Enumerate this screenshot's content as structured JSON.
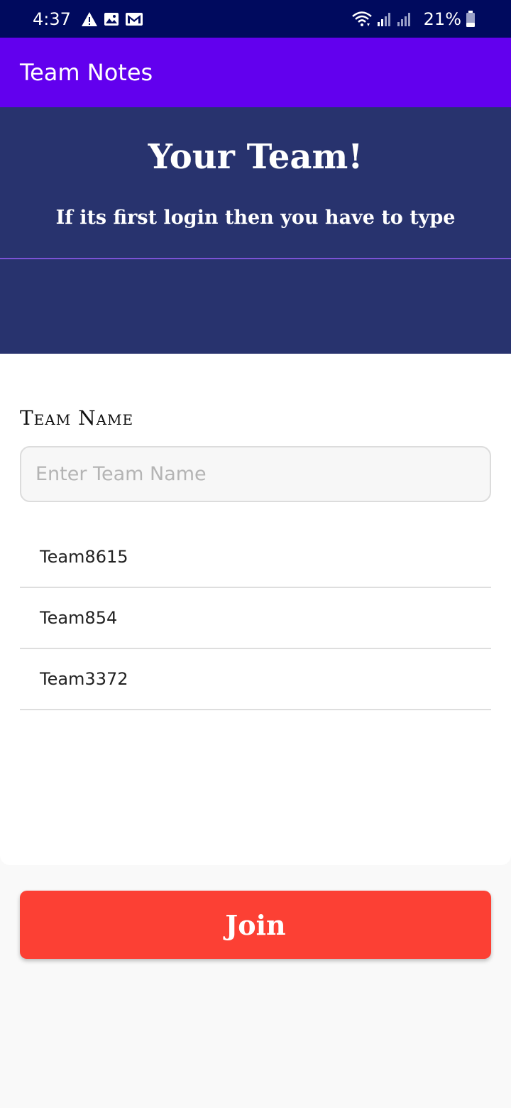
{
  "status_bar": {
    "time": "4:37",
    "battery": "21%",
    "icons": [
      "warning-icon",
      "image-icon",
      "gmail-icon",
      "wifi-icon",
      "signal-icon",
      "signal-icon",
      "battery-icon"
    ]
  },
  "app_bar": {
    "title": "Team Notes"
  },
  "hero": {
    "title": "Your Team!",
    "subtitle": "If its first login then you have to type"
  },
  "form": {
    "label": "Team Name",
    "input_placeholder": "Enter Team Name",
    "input_value": ""
  },
  "teams": [
    "Team8615",
    "Team854",
    "Team3372"
  ],
  "join_label": "Join",
  "colors": {
    "status_bar": "#000a5e",
    "app_bar": "#6200ee",
    "hero": "#28336e",
    "join_button": "#fc4034"
  }
}
